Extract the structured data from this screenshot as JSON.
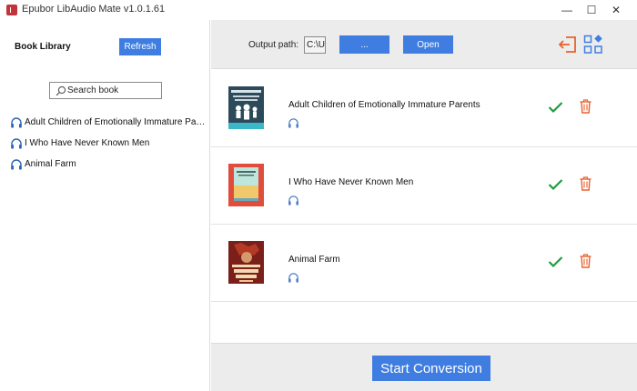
{
  "window": {
    "title": "Epubor LibAudio Mate v1.0.1.61",
    "minimize_glyph": "—",
    "maximize_glyph": "☐",
    "close_glyph": "✕"
  },
  "sidebar": {
    "title": "Book Library",
    "refresh_label": "Refresh",
    "search_placeholder": "Search book",
    "items": [
      {
        "label": "Adult Children of Emotionally Immature Parents",
        "icon": "headphones-icon"
      },
      {
        "label": "I Who Have Never Known Men",
        "icon": "headphones-icon"
      },
      {
        "label": "Animal Farm",
        "icon": "headphones-icon"
      }
    ]
  },
  "toolbar": {
    "output_label": "Output path:",
    "output_value": "C:\\Us",
    "browse_label": "...",
    "open_label": "Open"
  },
  "books": [
    {
      "title": "Adult Children of Emotionally Immature Parents",
      "status": "check-icon",
      "action": "trash-icon"
    },
    {
      "title": "I Who Have Never Known Men",
      "status": "check-icon",
      "action": "trash-icon"
    },
    {
      "title": "Animal Farm",
      "status": "check-icon",
      "action": "trash-icon"
    }
  ],
  "footer": {
    "convert_label": "Start Conversion"
  },
  "colors": {
    "accent": "#3f7ee0",
    "panel": "#ececec",
    "success": "#1f9d3a",
    "danger": "#e8622e"
  }
}
